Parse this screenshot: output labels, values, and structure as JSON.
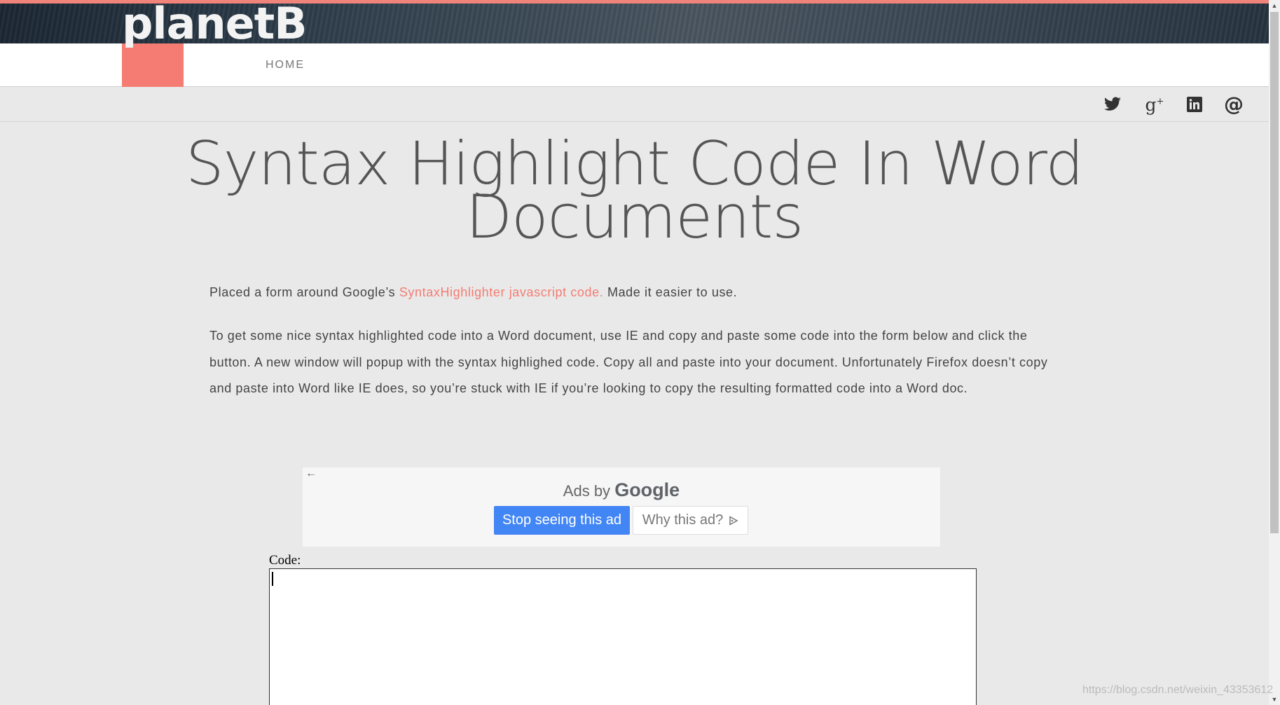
{
  "site": {
    "logo": "planetB",
    "nav_home": "HOME",
    "accent_color": "#f47c72"
  },
  "social": [
    "twitter-icon",
    "google-plus-icon",
    "linkedin-icon",
    "email-at-icon"
  ],
  "article": {
    "title": "Syntax Highlight Code In Word Documents",
    "intro_before": "Placed a form around Google’s ",
    "intro_link": "SyntaxHighlighter javascript code.",
    "intro_after": " Made it easier to use.",
    "body": "To get some nice syntax highlighted code into a Word document, use IE and copy and paste some code into the form below and click the button. A new window will popup with the syntax highlighed code. Copy all and paste into your document. Unfortunately Firefox doesn’t copy and paste into Word like IE does, so you’re stuck with IE if you’re looking to copy the resulting formatted code into a Word doc."
  },
  "ad": {
    "ads_by": "Ads by",
    "google": "Google",
    "stop_label": "Stop seeing this ad",
    "why_label": "Why this ad?",
    "stop_color": "#4285f4"
  },
  "form": {
    "code_label": "Code:",
    "code_value": ""
  },
  "watermark": "https://blog.csdn.net/weixin_43353612"
}
